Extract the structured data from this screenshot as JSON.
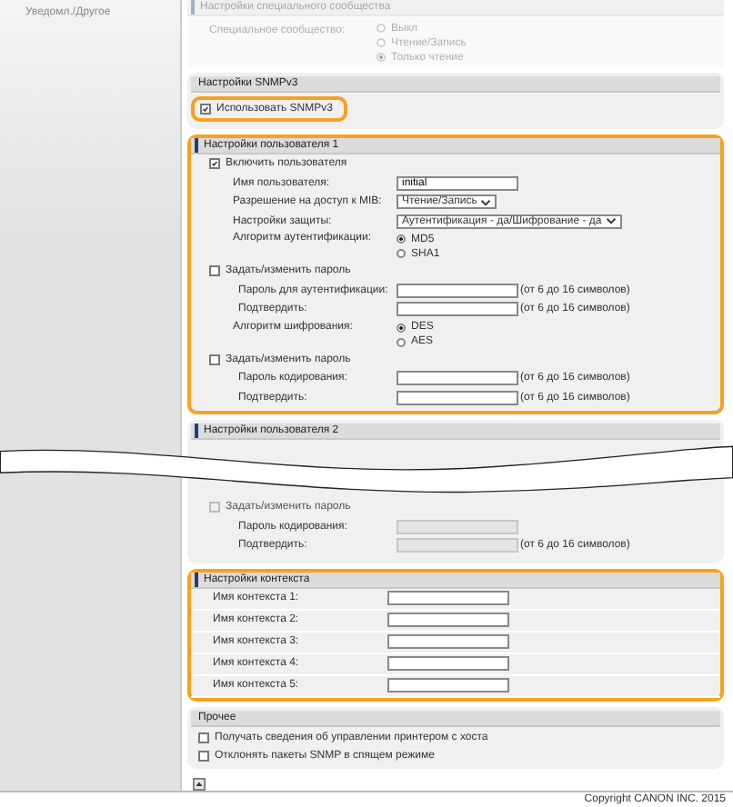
{
  "sidebar": {
    "items": [
      {
        "label": "Уведомл./Другое"
      }
    ]
  },
  "community": {
    "title": "Настройки специального сообщества",
    "label": "Специальное сообщество:",
    "options": [
      {
        "label": "Выкл",
        "selected": false
      },
      {
        "label": "Чтение/Запись",
        "selected": false
      },
      {
        "label": "Только чтение",
        "selected": true
      }
    ]
  },
  "snmpv3": {
    "title": "Настройки SNMPv3",
    "use": {
      "label": "Использовать SNMPv3",
      "checked": true,
      "highlighted": true
    }
  },
  "users": [
    {
      "title": "Настройки пользователя 1",
      "highlighted": true,
      "rows": [
        {
          "kind": "check",
          "label": "Включить пользователя",
          "checked": true,
          "disabled": false
        },
        {
          "kind": "field",
          "label": "Имя пользователя:",
          "value": "initial",
          "disabled": false
        },
        {
          "kind": "select",
          "label": "Разрешение на доступ к MIB:",
          "value": "Чтение/Запись",
          "disabled": false
        },
        {
          "kind": "select",
          "label": "Настройки защиты:",
          "value": "Аутентификация - да/Шифрование - да",
          "disabled": false
        },
        {
          "kind": "radios",
          "label": "Алгоритм аутентификации:",
          "options": [
            {
              "label": "MD5",
              "selected": true
            },
            {
              "label": "SHA1",
              "selected": false
            }
          ]
        },
        {
          "kind": "check",
          "label": "Задать/изменить пароль",
          "checked": false,
          "disabled": false,
          "children": [
            {
              "label": "Пароль для аутентификации:",
              "hint": "(от 6 до 16 символов)",
              "disabled": false
            },
            {
              "label": "Подтвердить:",
              "hint": "(от 6 до 16 символов)",
              "disabled": false
            }
          ]
        },
        {
          "kind": "radios",
          "label": "Алгоритм шифрования:",
          "options": [
            {
              "label": "DES",
              "selected": true
            },
            {
              "label": "AES",
              "selected": false
            }
          ]
        },
        {
          "kind": "check",
          "label": "Задать/изменить пароль",
          "checked": false,
          "disabled": false,
          "children": [
            {
              "label": "Пароль кодирования:",
              "hint": "(от 6 до 16 символов)",
              "disabled": false
            },
            {
              "label": "Подтвердить:",
              "hint": "(от 6 до 16 символов)",
              "disabled": false
            }
          ]
        }
      ]
    },
    {
      "title": "Настройки пользователя 2",
      "highlighted": false,
      "rows": [
        {
          "kind": "check",
          "label": "Задать/изменить пароль",
          "checked": false,
          "disabled": true,
          "children": [
            {
              "label": "Пароль кодирования:",
              "disabled": true
            },
            {
              "label": "Подтвердить:",
              "hint": "(от 6 до 16 символов)",
              "disabled": true
            }
          ]
        }
      ]
    }
  ],
  "context": {
    "title": "Настройки контекста",
    "highlighted": true,
    "rows": [
      {
        "label": "Имя контекста 1:"
      },
      {
        "label": "Имя контекста 2:"
      },
      {
        "label": "Имя контекста 3:"
      },
      {
        "label": "Имя контекста 4:"
      },
      {
        "label": "Имя контекста 5:"
      }
    ]
  },
  "other": {
    "title": "Прочее",
    "rows": [
      {
        "label": "Получать сведения об управлении принтером с хоста",
        "checked": false
      },
      {
        "label": "Отклонять пакеты SNMP в спящем режиме",
        "checked": false
      }
    ]
  },
  "footer": "Copyright CANON INC. 2015"
}
